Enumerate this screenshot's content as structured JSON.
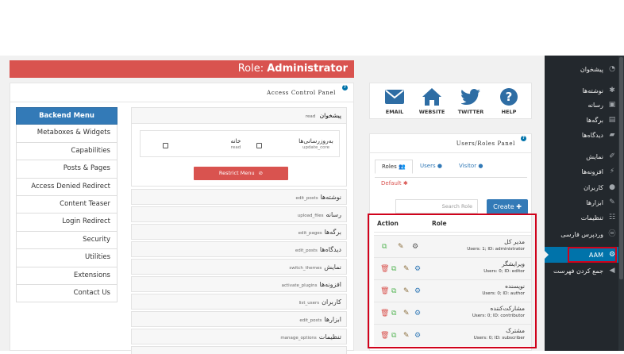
{
  "title": {
    "prefix": "Role: ",
    "role": "Administrator"
  },
  "acp": {
    "heading": "Access Control Panel",
    "help": "?",
    "menu": [
      "Backend Menu",
      "Metaboxes & Widgets",
      "Capabilities",
      "Posts & Pages",
      "Access Denied Redirect",
      "Content Teaser",
      "Login Redirect",
      "Security",
      "Utilities",
      "Extensions",
      "Contact Us"
    ],
    "dashboard": {
      "title": "پیشخوان",
      "cap": "read",
      "items": [
        {
          "label": "خانه",
          "cap": "read"
        },
        {
          "label": "به‌روزرسانی‌ها",
          "cap": "update_core"
        }
      ],
      "restrict_label": "Restrict Menu"
    },
    "submenus": [
      {
        "title": "نوشته‌ها",
        "cap": "edit_posts"
      },
      {
        "title": "رسانه",
        "cap": "upload_files"
      },
      {
        "title": "برگه‌ها",
        "cap": "edit_pages"
      },
      {
        "title": "دیدگاه‌ها",
        "cap": "edit_posts"
      },
      {
        "title": "نمایش",
        "cap": "switch_themes"
      },
      {
        "title": "افزونه‌ها",
        "cap": "activate_plugins"
      },
      {
        "title": "کاربران",
        "cap": "list_users"
      },
      {
        "title": "ابزارها",
        "cap": "edit_posts"
      },
      {
        "title": "تنظیمات",
        "cap": "manage_options"
      }
    ]
  },
  "support": {
    "email": "EMAIL",
    "website": "WEBSITE",
    "twitter": "TWITTER",
    "help": "HELP"
  },
  "users_roles": {
    "heading": "Users/Roles Panel",
    "tabs": {
      "roles": "Roles",
      "users": "Users",
      "visitor": "Visitor",
      "default": "Default"
    },
    "search_placeholder": "Search Role",
    "create_label": "Create",
    "columns": {
      "action": "Action",
      "role": "Role"
    },
    "roles": [
      {
        "name": "مدیر کل",
        "meta": "Users: 1; ID: administrator"
      },
      {
        "name": "ویرایشگر",
        "meta": "Users: 0; ID: editor"
      },
      {
        "name": "نویسنده",
        "meta": "Users: 0; ID: author"
      },
      {
        "name": "مشارکت‌کننده",
        "meta": "Users: 0; ID: contributor"
      },
      {
        "name": "مشترک",
        "meta": "Users: 0; ID: subscriber"
      }
    ]
  },
  "admin_menu": {
    "items": [
      "پیشخوان",
      "نوشته‌ها",
      "رسانه",
      "برگه‌ها",
      "دیدگاه‌ها",
      "نمایش",
      "افزونه‌ها",
      "کاربران",
      "ابزارها",
      "تنظیمات",
      "وردپرس فارسی",
      "AAM",
      "جمع کردن فهرست"
    ],
    "active": "AAM"
  },
  "colors": {
    "title_bar": "#d9534f",
    "primary": "#337ab7",
    "admin_bg": "#23282d",
    "highlight": "#d0021b"
  }
}
